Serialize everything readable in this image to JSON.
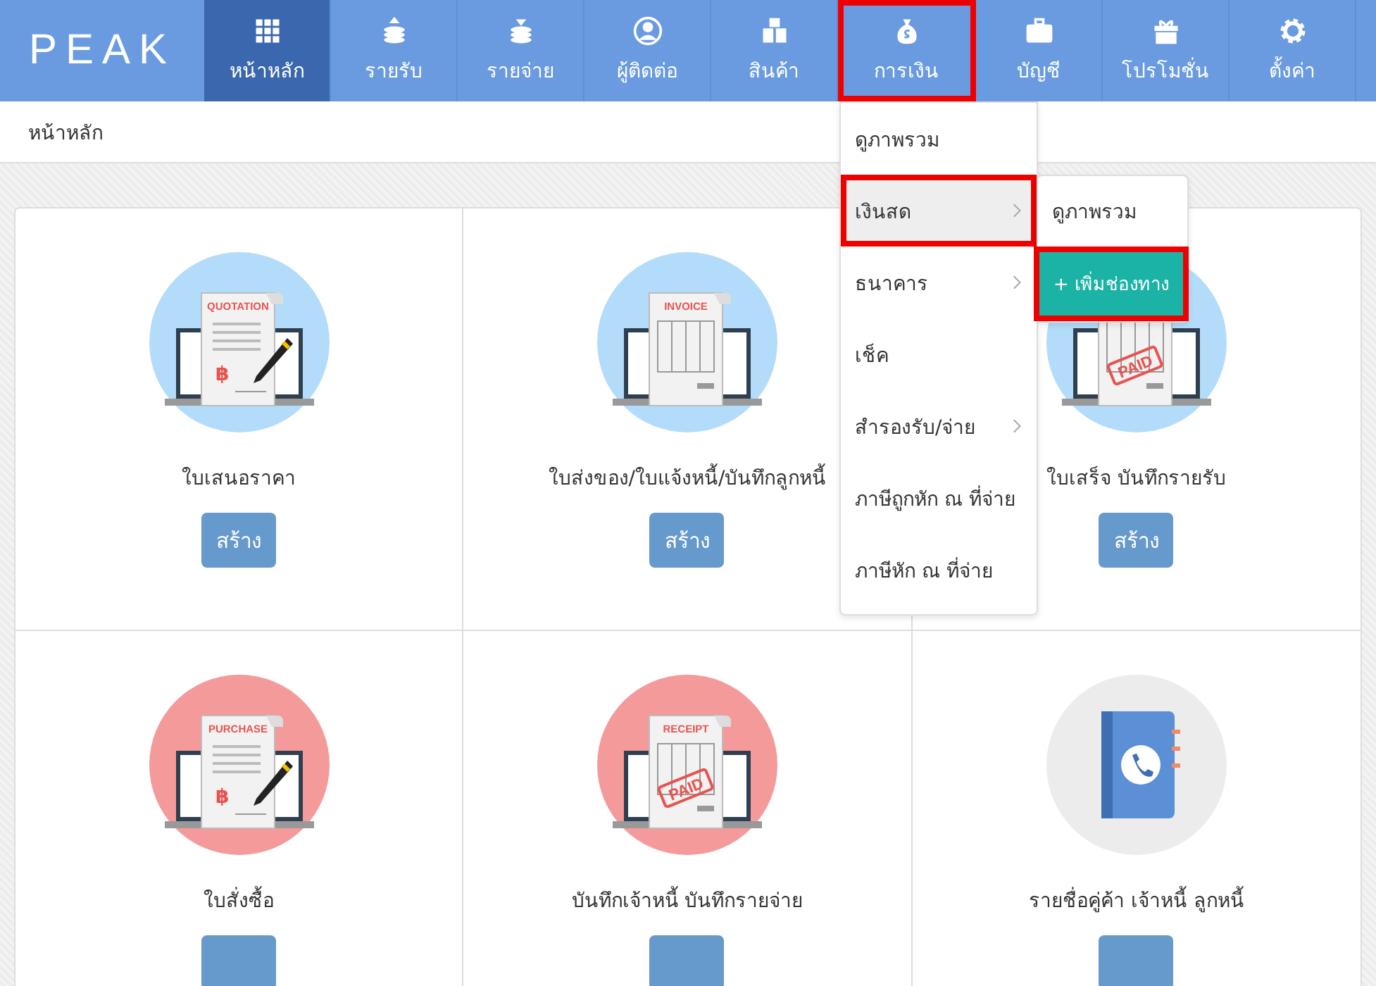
{
  "logo": "PEAK",
  "nav": [
    {
      "label": "หน้าหลัก",
      "kind": "grid",
      "selected": true,
      "highlighted": false
    },
    {
      "label": "รายรับ",
      "kind": "coins-up",
      "selected": false,
      "highlighted": false
    },
    {
      "label": "รายจ่าย",
      "kind": "coins-down",
      "selected": false,
      "highlighted": false
    },
    {
      "label": "ผู้ติดต่อ",
      "kind": "person",
      "selected": false,
      "highlighted": false
    },
    {
      "label": "สินค้า",
      "kind": "boxes",
      "selected": false,
      "highlighted": false
    },
    {
      "label": "การเงิน",
      "kind": "bag",
      "selected": false,
      "highlighted": true
    },
    {
      "label": "บัญชี",
      "kind": "briefcase",
      "selected": false,
      "highlighted": false
    },
    {
      "label": "โปรโมชั่น",
      "kind": "gift",
      "selected": false,
      "highlighted": false
    },
    {
      "label": "ตั้งค่า",
      "kind": "gear",
      "selected": false,
      "highlighted": false
    }
  ],
  "breadcrumb": "หน้าหลัก",
  "cards": [
    {
      "title": "ใบเสนอราคา",
      "button": "สร้าง",
      "kind": "doc",
      "color": "#b3dcfa",
      "doc_label": "QUOTATION",
      "currency": "฿"
    },
    {
      "title": "ใบส่งของ/ใบแจ้งหนี้/บันทึกลูกหนี้",
      "button": "สร้าง",
      "kind": "table-doc",
      "color": "#b3dcfa",
      "doc_label": "INVOICE"
    },
    {
      "title": "ใบเสร็จ บันทึกรายรับ",
      "button": "สร้าง",
      "kind": "table-doc",
      "color": "#b3dcfa",
      "stamp": "PAID"
    },
    {
      "title": "ใบสั่งซื้อ",
      "kind": "doc",
      "color": "#f49a9a",
      "doc_label": "PURCHASE",
      "currency": "฿"
    },
    {
      "title": "บันทึกเจ้าหนี้ บันทึกรายจ่าย",
      "kind": "table-doc",
      "color": "#f49a9a",
      "doc_label": "RECEIPT",
      "stamp": "PAID"
    },
    {
      "title": "รายชื่อคู่ค้า เจ้าหนี้ ลูกหนี้",
      "kind": "phonebook",
      "color": "#ececec"
    }
  ],
  "menu": [
    {
      "label": "ดูภาพรวม",
      "has_submenu": false,
      "selected": false,
      "highlighted": false
    },
    {
      "label": "เงินสด",
      "has_submenu": true,
      "selected": true,
      "highlighted": true
    },
    {
      "label": "ธนาคาร",
      "has_submenu": true,
      "selected": false,
      "highlighted": false
    },
    {
      "label": "เช็ค",
      "has_submenu": false,
      "selected": false,
      "highlighted": false
    },
    {
      "label": "สำรองรับ/จ่าย",
      "has_submenu": true,
      "selected": false,
      "highlighted": false
    },
    {
      "label": "ภาษีถูกหัก ณ ที่จ่าย",
      "has_submenu": false,
      "selected": false,
      "highlighted": false
    },
    {
      "label": "ภาษีหัก ณ ที่จ่าย",
      "has_submenu": false,
      "selected": false,
      "highlighted": false
    }
  ],
  "submenu": [
    {
      "label": "ดูภาพรวม",
      "kind": "link",
      "highlighted": false
    },
    {
      "label": "+ เพิ่มช่องทาง",
      "kind": "button",
      "highlighted": true
    }
  ]
}
